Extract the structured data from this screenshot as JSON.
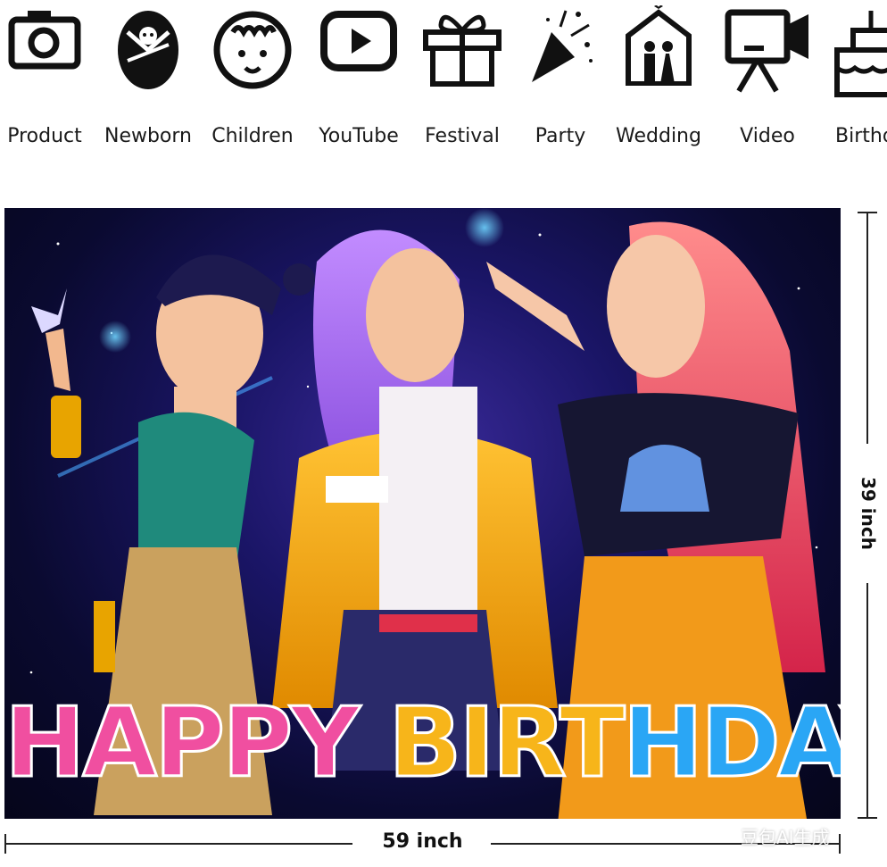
{
  "categories": [
    {
      "label": "Product",
      "icon": "camera-icon"
    },
    {
      "label": "Newborn",
      "icon": "newborn-icon"
    },
    {
      "label": "Children",
      "icon": "children-icon"
    },
    {
      "label": "YouTube",
      "icon": "youtube-icon"
    },
    {
      "label": "Festival",
      "icon": "gift-icon"
    },
    {
      "label": "Party",
      "icon": "party-popper-icon"
    },
    {
      "label": "Wedding",
      "icon": "wedding-icon"
    },
    {
      "label": "Video",
      "icon": "video-camera-icon"
    },
    {
      "label": "Birthd",
      "icon": "birthday-cake-icon"
    }
  ],
  "backdrop": {
    "headline_word1": "HAPPY",
    "headline_word2": "BIRT",
    "headline_word3": "HDAY"
  },
  "dimensions": {
    "width_label": "59 inch",
    "height_label": "39 inch"
  },
  "watermark": "豆包AI生成",
  "colors": {
    "headline_pink": "#f04fa0",
    "headline_yellow": "#f7b51a",
    "headline_blue": "#2aa6f5",
    "background_space": "#1a1566"
  }
}
